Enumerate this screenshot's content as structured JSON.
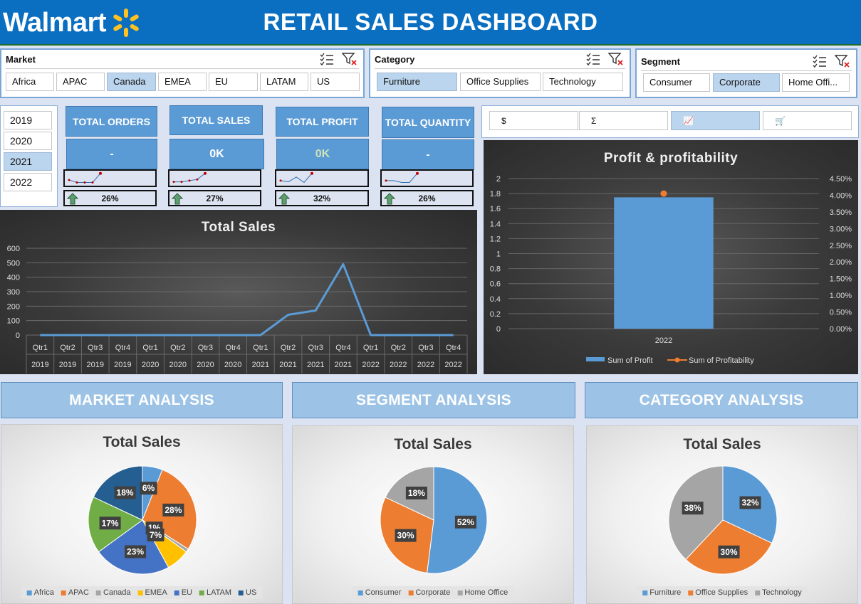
{
  "header": {
    "logo_text": "Walmart",
    "title": "RETAIL SALES DASHBOARD"
  },
  "slicers": {
    "market": {
      "title": "Market",
      "items": [
        "Africa",
        "APAC",
        "Canada",
        "EMEA",
        "EU",
        "LATAM",
        "US"
      ],
      "selected": "Canada"
    },
    "category": {
      "title": "Category",
      "items": [
        "Furniture",
        "Office Supplies",
        "Technology"
      ],
      "selected": "Furniture"
    },
    "segment": {
      "title": "Segment",
      "items": [
        "Consumer",
        "Corporate",
        "Home Offi..."
      ],
      "selected": "Corporate"
    },
    "years": {
      "items": [
        "2019",
        "2020",
        "2021",
        "2022"
      ],
      "selected": "2021"
    }
  },
  "kpis": [
    {
      "title": "TOTAL ORDERS",
      "value": "-",
      "pct": "26%",
      "trend": [
        0.35,
        0.15,
        0.15,
        0.15,
        0.9
      ]
    },
    {
      "title": "TOTAL SALES",
      "value": "0K",
      "pct": "27%",
      "trend": [
        0.2,
        0.2,
        0.3,
        0.4,
        0.9
      ]
    },
    {
      "title": "TOTAL PROFIT",
      "value": "0K",
      "pct": "32%",
      "trend": [
        0.3,
        0.2,
        0.6,
        0.15,
        0.9
      ]
    },
    {
      "title": "TOTAL QUANTITY",
      "value": "-",
      "pct": "26%",
      "trend": [
        0.3,
        0.3,
        0.15,
        0.15,
        0.9
      ]
    }
  ],
  "metric_buttons": [
    {
      "symbol": "$",
      "icon": "dollar-icon"
    },
    {
      "symbol": "Σ",
      "icon": "sigma-icon"
    },
    {
      "symbol": "📈",
      "icon": "line-chart-icon",
      "selected": true
    },
    {
      "symbol": "🛒",
      "icon": "cart-icon"
    }
  ],
  "sections": {
    "market": "MARKET ANALYSIS",
    "segment": "SEGMENT ANALYSIS",
    "category": "CATEGORY ANALYSIS"
  },
  "chart_data": [
    {
      "type": "line",
      "title": "Total Sales",
      "categories": [
        "Qtr1",
        "Qtr2",
        "Qtr3",
        "Qtr4",
        "Qtr1",
        "Qtr2",
        "Qtr3",
        "Qtr4",
        "Qtr1",
        "Qtr2",
        "Qtr3",
        "Qtr4",
        "Qtr1",
        "Qtr2",
        "Qtr3",
        "Qtr4"
      ],
      "years": [
        "2019",
        "2019",
        "2019",
        "2019",
        "2020",
        "2020",
        "2020",
        "2020",
        "2021",
        "2021",
        "2021",
        "2021",
        "2022",
        "2022",
        "2022",
        "2022"
      ],
      "values": [
        0,
        0,
        0,
        0,
        0,
        0,
        0,
        0,
        0,
        140,
        170,
        490,
        0,
        0,
        0,
        0
      ],
      "ylim": [
        0,
        600
      ],
      "yticks": [
        0,
        100,
        200,
        300,
        400,
        500,
        600
      ],
      "grid": true,
      "color": "#5b9bd5"
    },
    {
      "type": "bar",
      "title": "Profit & profitability",
      "categories": [
        "2022"
      ],
      "series": [
        {
          "name": "Sum of Profit",
          "values": [
            1.75
          ],
          "axis": "left",
          "color": "#5b9bd5"
        },
        {
          "name": "Sum of Profitability",
          "values": [
            0.0405
          ],
          "axis": "right",
          "type": "line",
          "color": "#ed7d31"
        }
      ],
      "ylim": [
        0,
        2
      ],
      "yticks": [
        "0",
        "0.2",
        "0.4",
        "0.6",
        "0.8",
        "1",
        "1.2",
        "1.4",
        "1.6",
        "1.8",
        "2"
      ],
      "y2lim": [
        0,
        0.045
      ],
      "y2ticks": [
        "0.00%",
        "0.50%",
        "1.00%",
        "1.50%",
        "2.00%",
        "2.50%",
        "3.00%",
        "3.50%",
        "4.00%",
        "4.50%"
      ],
      "legend": "bottom"
    },
    {
      "type": "pie",
      "title": "Total Sales",
      "labels": [
        "Africa",
        "APAC",
        "Canada",
        "EMEA",
        "EU",
        "LATAM",
        "US"
      ],
      "values": [
        6,
        28,
        1,
        7,
        23,
        17,
        18
      ],
      "label_text": [
        "6%",
        "28%",
        "1%",
        "7%",
        "23%",
        "17%",
        "18%"
      ],
      "colors": [
        "#5b9bd5",
        "#ed7d31",
        "#a5a5a5",
        "#ffc000",
        "#4472c4",
        "#70ad47",
        "#255e91"
      ],
      "legend": "bottom"
    },
    {
      "type": "pie",
      "title": "Total Sales",
      "labels": [
        "Consumer",
        "Corporate",
        "Home Office"
      ],
      "values": [
        52,
        30,
        18
      ],
      "label_text": [
        "52%",
        "30%",
        "18%"
      ],
      "colors": [
        "#5b9bd5",
        "#ed7d31",
        "#a5a5a5"
      ],
      "legend": "bottom"
    },
    {
      "type": "pie",
      "title": "Total Sales",
      "labels": [
        "Furniture",
        "Office Supplies",
        "Technology"
      ],
      "values": [
        32,
        30,
        38
      ],
      "label_text": [
        "32%",
        "30%",
        "38%"
      ],
      "colors": [
        "#5b9bd5",
        "#ed7d31",
        "#a5a5a5"
      ],
      "legend": "bottom"
    }
  ]
}
